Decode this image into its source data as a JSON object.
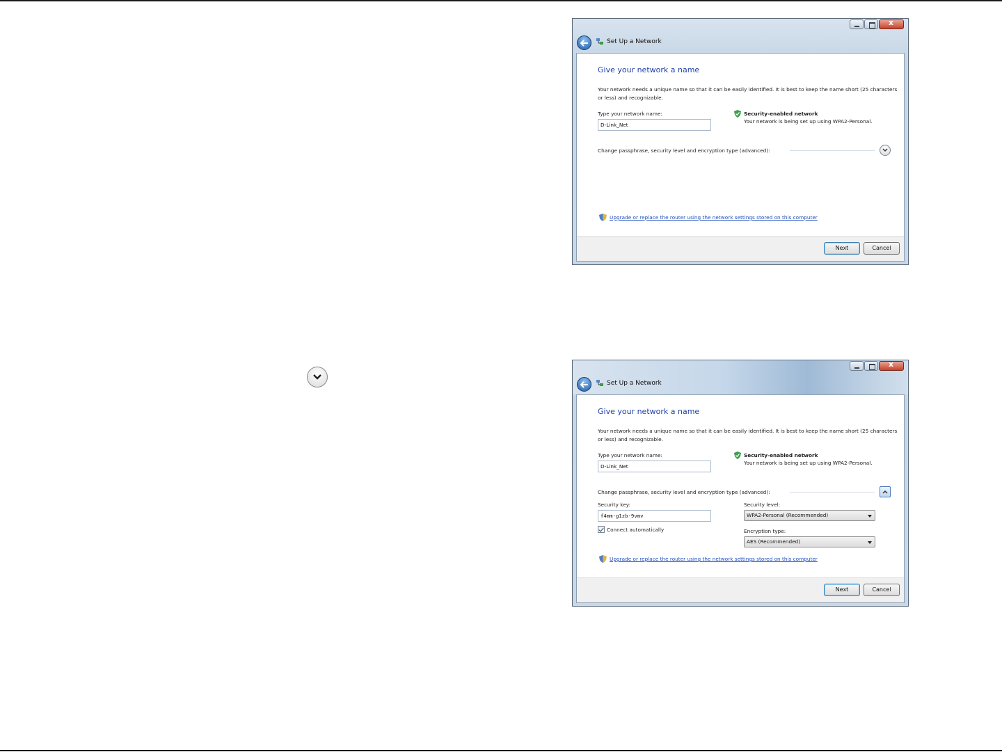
{
  "windows": [
    {
      "title": "Set Up a Network",
      "heading": "Give your network a name",
      "description": "Your network needs a unique name so that it can be easily identified. It is best to keep the name short (25 characters or less) and recognizable.",
      "name_label": "Type your network name:",
      "name_value": "D-Link_Net",
      "security_title": "Security-enabled network",
      "security_desc": "Your network is being set up using WPA2-Personal.",
      "advanced_label": "Change passphrase, security level and encryption type (advanced):",
      "link": "Upgrade or replace the router using the network settings stored on this computer",
      "next_label": "Next",
      "cancel_label": "Cancel"
    },
    {
      "title": "Set Up a Network",
      "heading": "Give your network a name",
      "description": "Your network needs a unique name so that it can be easily identified. It is best to keep the name short (25 characters or less) and recognizable.",
      "name_label": "Type your network name:",
      "name_value": "D-Link_Net",
      "security_title": "Security-enabled network",
      "security_desc": "Your network is being set up using WPA2-Personal.",
      "advanced_label": "Change passphrase, security level and encryption type (advanced):",
      "security_key_label": "Security key:",
      "security_key_value": "f4mm-g1zb-9vmv",
      "security_level_label": "Security level:",
      "security_level_value": "WPA2-Personal (Recommended)",
      "connect_auto_label": "Connect automatically",
      "connect_auto_checked": true,
      "encryption_label": "Encryption type:",
      "encryption_value": "AES (Recommended)",
      "link": "Upgrade or replace the router using the network settings stored on this computer",
      "next_label": "Next",
      "cancel_label": "Cancel"
    }
  ],
  "icons": {
    "lone_expand": "chevron-down-icon",
    "back": "back-arrow-icon",
    "network": "network-icon",
    "security": "shield-check-icon",
    "uac": "uac-shield-icon"
  },
  "colors": {
    "heading": "#1f3fa6",
    "link": "#1f4fbf",
    "shield_green": "#3aa04a"
  }
}
